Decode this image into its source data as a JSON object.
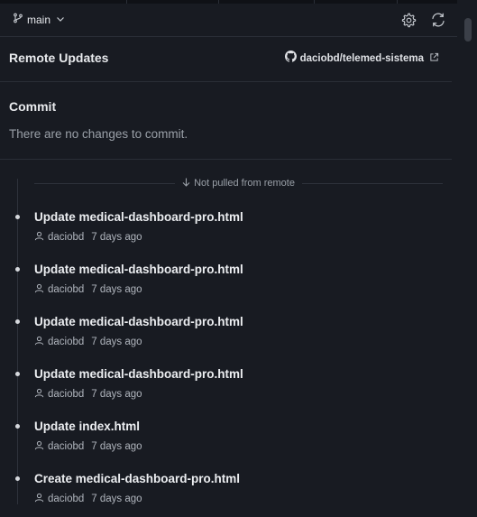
{
  "header": {
    "branch_label": "main"
  },
  "remote": {
    "title": "Remote Updates",
    "repo": "daciobd/telemed-sistema"
  },
  "commit_section": {
    "title": "Commit",
    "message": "There are no changes to commit."
  },
  "timeline": {
    "divider_label": "Not pulled from remote",
    "commits": [
      {
        "message": "Update medical-dashboard-pro.html",
        "author": "daciobd",
        "time": "7 days ago"
      },
      {
        "message": "Update medical-dashboard-pro.html",
        "author": "daciobd",
        "time": "7 days ago"
      },
      {
        "message": "Update medical-dashboard-pro.html",
        "author": "daciobd",
        "time": "7 days ago"
      },
      {
        "message": "Update medical-dashboard-pro.html",
        "author": "daciobd",
        "time": "7 days ago"
      },
      {
        "message": "Update index.html",
        "author": "daciobd",
        "time": "7 days ago"
      },
      {
        "message": "Create medical-dashboard-pro.html",
        "author": "daciobd",
        "time": "7 days ago"
      }
    ]
  },
  "icons": {
    "branch": "git-branch-icon",
    "chevron": "chevron-down-icon",
    "settings": "gear-icon",
    "refresh": "refresh-icon",
    "github": "github-icon",
    "external": "external-link-icon",
    "arrow_down": "arrow-down-icon",
    "person": "person-icon"
  },
  "colors": {
    "background": "#181b22",
    "border": "#2a2e37",
    "text_primary": "#e6e8ec",
    "text_muted": "#9aa0a8"
  }
}
